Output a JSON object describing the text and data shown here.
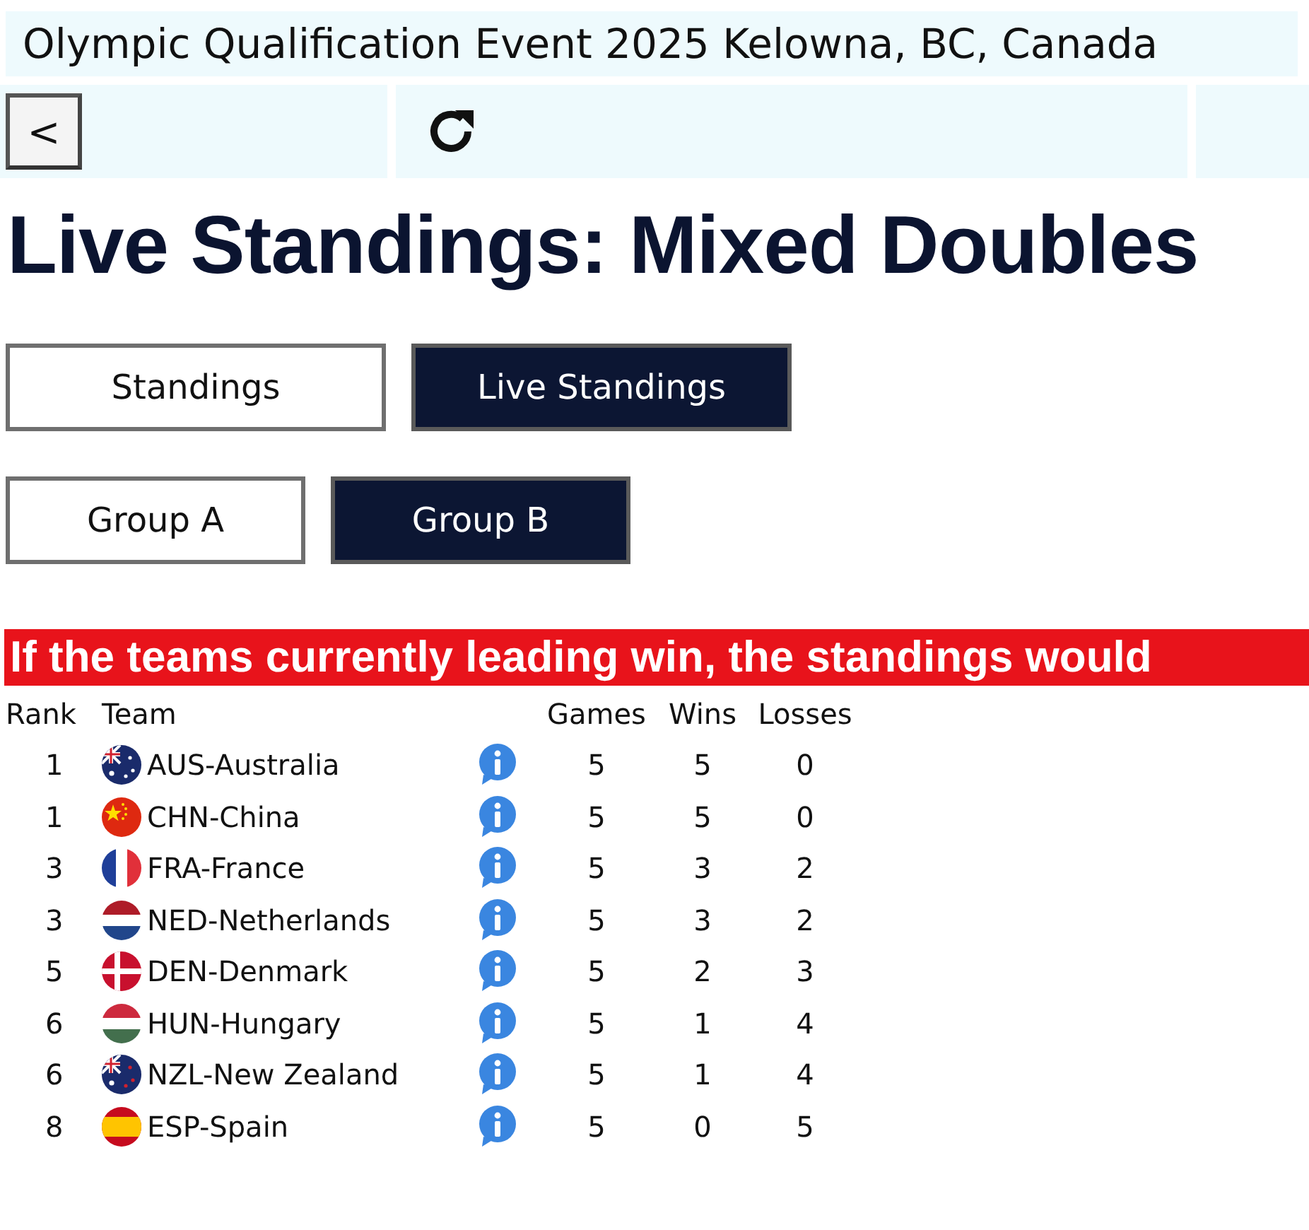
{
  "header": {
    "title": "Olympic Qualification Event 2025 Kelowna, BC, Canada",
    "back_button": "<"
  },
  "heading": "Live Standings: Mixed Doubles",
  "view_tabs": [
    {
      "label": "Standings",
      "selected": false
    },
    {
      "label": "Live Standings",
      "selected": true
    }
  ],
  "group_tabs": [
    {
      "label": "Group A",
      "selected": false
    },
    {
      "label": "Group B",
      "selected": true
    }
  ],
  "banner": "If the teams currently leading win, the standings would",
  "table": {
    "columns": [
      "Rank",
      "Team",
      "Games",
      "Wins",
      "Losses"
    ],
    "rows": [
      {
        "rank": "1",
        "team": "AUS-Australia",
        "kind": "aus",
        "games": "5",
        "wins": "5",
        "losses": "0"
      },
      {
        "rank": "1",
        "team": "CHN-China",
        "kind": "chn",
        "games": "5",
        "wins": "5",
        "losses": "0"
      },
      {
        "rank": "3",
        "team": "FRA-France",
        "kind": "fra",
        "games": "5",
        "wins": "3",
        "losses": "2"
      },
      {
        "rank": "3",
        "team": "NED-Netherlands",
        "kind": "ned",
        "games": "5",
        "wins": "3",
        "losses": "2"
      },
      {
        "rank": "5",
        "team": "DEN-Denmark",
        "kind": "den",
        "games": "5",
        "wins": "2",
        "losses": "3"
      },
      {
        "rank": "6",
        "team": "HUN-Hungary",
        "kind": "hun",
        "games": "5",
        "wins": "1",
        "losses": "4"
      },
      {
        "rank": "6",
        "team": "NZL-New Zealand",
        "kind": "nzl",
        "games": "5",
        "wins": "1",
        "losses": "4"
      },
      {
        "rank": "8",
        "team": "ESP-Spain",
        "kind": "esp",
        "games": "5",
        "wins": "0",
        "losses": "5"
      }
    ]
  }
}
